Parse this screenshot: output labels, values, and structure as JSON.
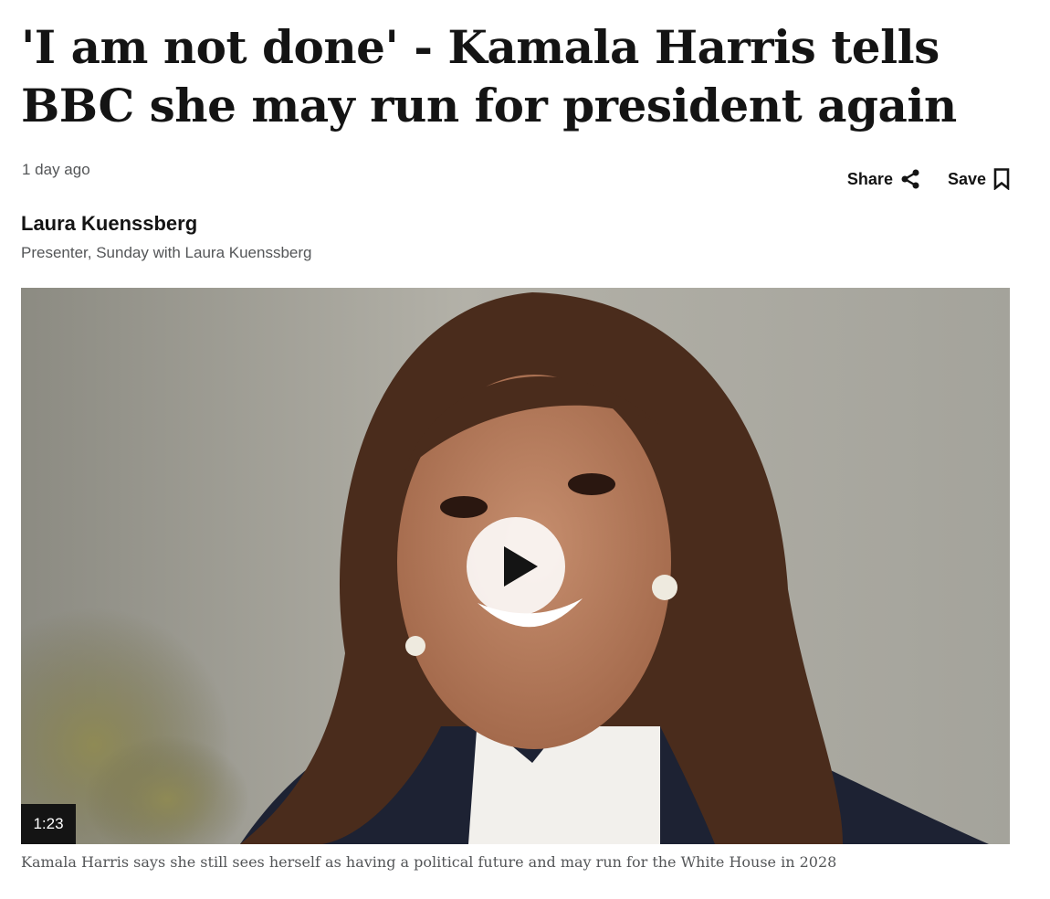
{
  "article": {
    "headline": "'I am not done' - Kamala Harris tells BBC she may run for president again",
    "timestamp": "1 day ago",
    "actions": {
      "share_label": "Share",
      "save_label": "Save"
    },
    "author": {
      "name": "Laura Kuenssberg",
      "role": "Presenter, Sunday with Laura Kuenssberg"
    },
    "video": {
      "duration": "1:23",
      "caption": "Kamala Harris says she still sees herself as having a political future and may run for the White House in 2028"
    },
    "icons": {
      "share": "share-icon",
      "save": "bookmark-icon",
      "play": "play-icon"
    },
    "colors": {
      "text": "#141414",
      "secondary_text": "#545658",
      "duration_badge": "#141414"
    }
  }
}
